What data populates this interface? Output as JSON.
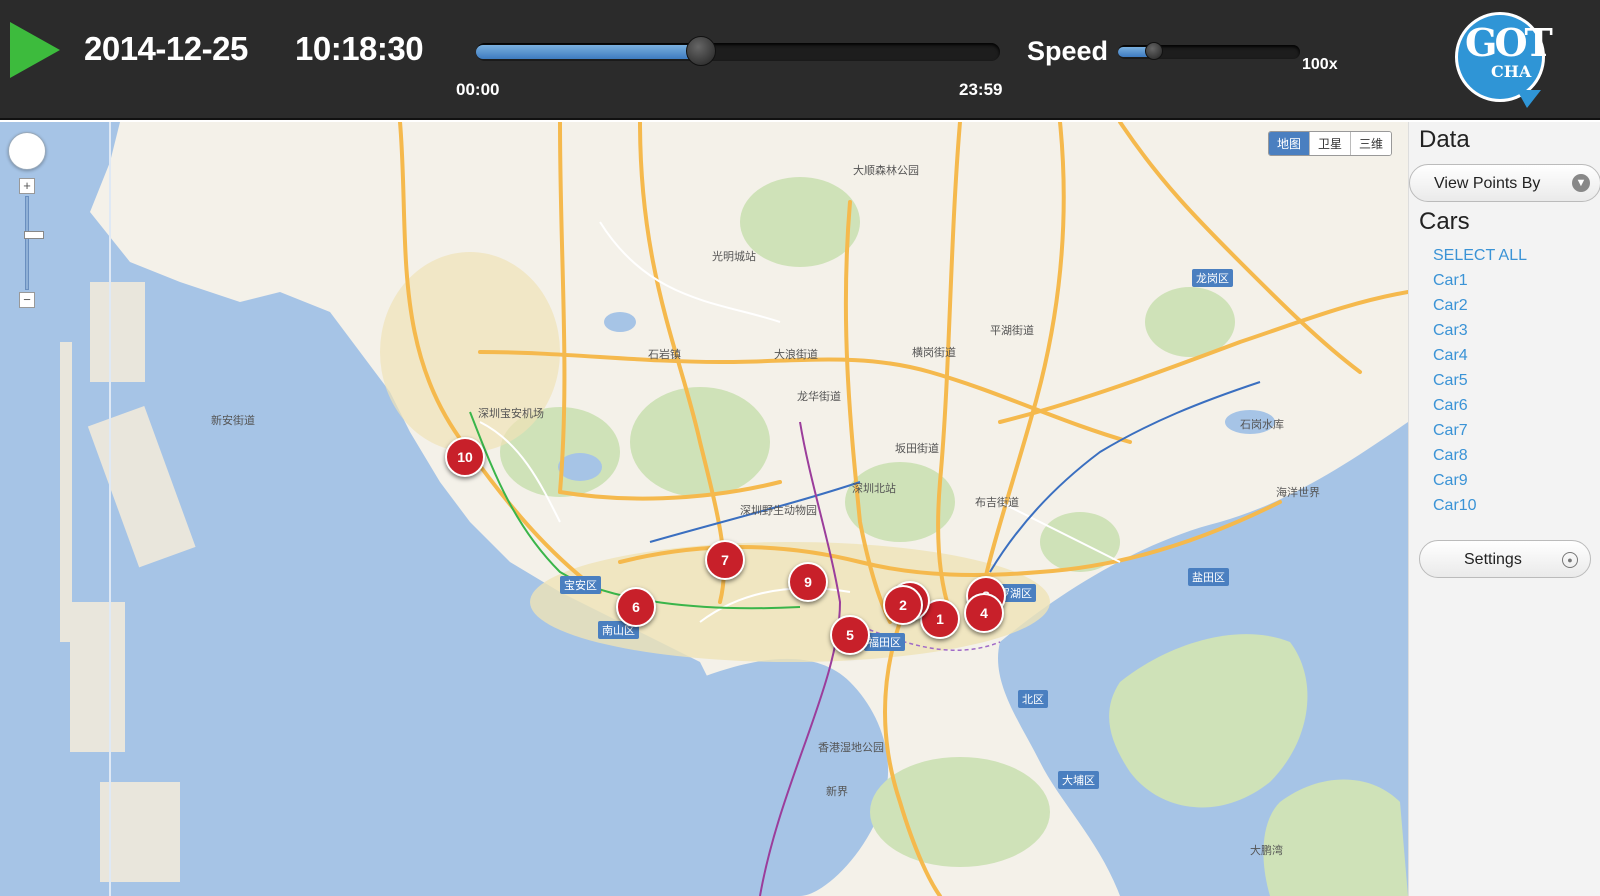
{
  "player": {
    "date": "2014-12-25",
    "time": "10:18:30",
    "timeline": {
      "start": "00:00",
      "end": "23:59",
      "progress": 0.43
    },
    "speed": {
      "label": "Speed",
      "value": "100x",
      "level": 0.2
    }
  },
  "logo": {
    "line1": "GOT",
    "line2": "CHA"
  },
  "map": {
    "type_buttons": [
      "地图",
      "卫星",
      "三维"
    ],
    "places": [
      {
        "name": "深圳宝安机场"
      },
      {
        "name": "光明城站"
      },
      {
        "name": "大顺森林公园"
      },
      {
        "name": "石岩镇"
      },
      {
        "name": "大浪街道"
      },
      {
        "name": "龙华街道"
      },
      {
        "name": "深圳野生动物园"
      },
      {
        "name": "深圳北站"
      },
      {
        "name": "平湖街道"
      },
      {
        "name": "横岗街道"
      },
      {
        "name": "坂田街道"
      },
      {
        "name": "布吉街道"
      },
      {
        "name": "新界"
      },
      {
        "name": "香港湿地公园"
      },
      {
        "name": "石岗水库"
      },
      {
        "name": "新安街道"
      },
      {
        "name": "海洋世界"
      },
      {
        "name": "大鹏湾"
      }
    ],
    "districts": [
      {
        "name": "宝安区"
      },
      {
        "name": "南山区"
      },
      {
        "name": "福田区"
      },
      {
        "name": "罗湖区"
      },
      {
        "name": "盐田区"
      },
      {
        "name": "龙岗区"
      },
      {
        "name": "北区"
      },
      {
        "name": "大埔区"
      }
    ],
    "markers": [
      "1",
      "2",
      "3",
      "4",
      "5",
      "6",
      "7",
      "8",
      "9",
      "10"
    ]
  },
  "sidebar": {
    "data_title": "Data",
    "view_points_by": "View Points By",
    "cars_title": "Cars",
    "select_all": "SELECT ALL",
    "cars": [
      "Car1",
      "Car2",
      "Car3",
      "Car4",
      "Car5",
      "Car6",
      "Car7",
      "Car8",
      "Car9",
      "Car10"
    ],
    "settings": "Settings"
  },
  "colors": {
    "marker": "#c8202a",
    "water": "#a6c4e6",
    "accent": "#3a93d6",
    "play": "#3dbb3d"
  }
}
